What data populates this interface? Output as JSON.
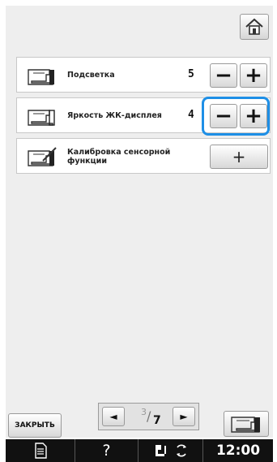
{
  "header": {
    "home_icon": "home-icon"
  },
  "settings": [
    {
      "label": "Подсветка",
      "value": "5",
      "icon": "machine-light-icon",
      "minus": "−",
      "plus": "+"
    },
    {
      "label": "Яркость ЖК-дисплея",
      "value": "4",
      "icon": "machine-lcd-icon",
      "minus": "−",
      "plus": "+"
    },
    {
      "label": "Калибровка сенсорной функции",
      "icon": "touch-calibration-icon",
      "button": "+"
    }
  ],
  "footer": {
    "close_label": "ЗАКРЫТЬ",
    "page_current": "3",
    "page_slash": "/",
    "page_total": "7",
    "prev": "◄",
    "next": "►"
  },
  "statusbar": {
    "help": "?",
    "time": "12:00",
    "icons": [
      "document-icon",
      "presser-foot-icon",
      "rotation-icon"
    ]
  },
  "colors": {
    "highlight": "#1e8fe6",
    "statusbar": "#111111"
  }
}
